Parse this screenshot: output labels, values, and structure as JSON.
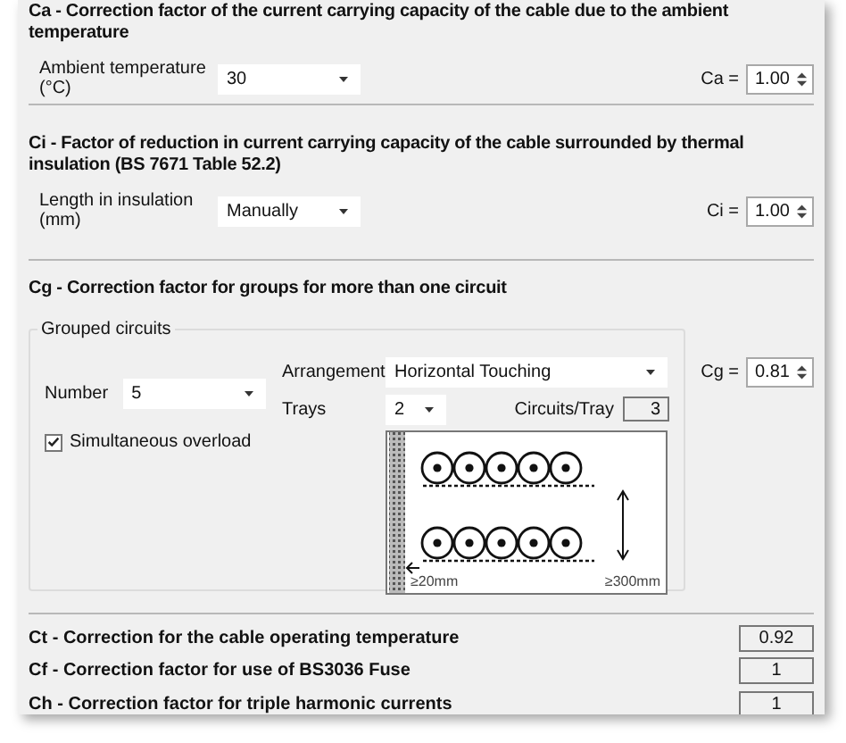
{
  "ca": {
    "title": "Ca - Correction factor of the current carrying capacity of the cable due to the ambient temperature",
    "field_label": "Ambient temperature (°C)",
    "field_value": "30",
    "factor_label": "Ca =",
    "factor_value": "1.00"
  },
  "ci": {
    "title": "Ci - Factor of reduction in current carrying capacity of the cable surrounded by thermal insulation (BS 7671 Table 52.2)",
    "field_label": "Length in insulation (mm)",
    "field_value": "Manually",
    "factor_label": "Ci =",
    "factor_value": "1.00"
  },
  "cg": {
    "title": "Cg - Correction factor for groups for more than one circuit",
    "group_label": "Grouped circuits",
    "number_label": "Number",
    "number_value": "5",
    "simultaneous": {
      "label": "Simultaneous overload",
      "checked": true
    },
    "arrangement_label": "Arrangement",
    "arrangement_value": "Horizontal Touching",
    "trays_label": "Trays",
    "trays_value": "2",
    "circuits_label": "Circuits/Tray",
    "circuits_value": "3",
    "diagram": {
      "gap_label": "≥20mm",
      "spacing_label": "≥300mm"
    },
    "factor_label": "Cg =",
    "factor_value": "0.81"
  },
  "results": [
    {
      "label": "Ct - Correction for the cable operating temperature",
      "value": "0.92"
    },
    {
      "label": "Cf - Correction factor for use of BS3036 Fuse",
      "value": "1"
    },
    {
      "label": "Ch - Correction factor for triple harmonic currents",
      "value": "1"
    }
  ]
}
